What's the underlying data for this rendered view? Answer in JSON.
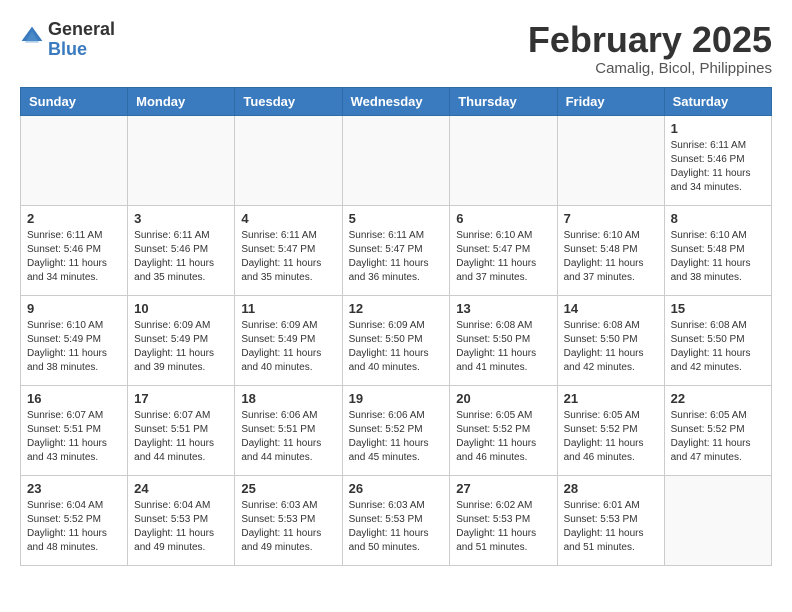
{
  "header": {
    "logo_general": "General",
    "logo_blue": "Blue",
    "month_year": "February 2025",
    "location": "Camalig, Bicol, Philippines"
  },
  "weekdays": [
    "Sunday",
    "Monday",
    "Tuesday",
    "Wednesday",
    "Thursday",
    "Friday",
    "Saturday"
  ],
  "weeks": [
    [
      {
        "day": "",
        "info": ""
      },
      {
        "day": "",
        "info": ""
      },
      {
        "day": "",
        "info": ""
      },
      {
        "day": "",
        "info": ""
      },
      {
        "day": "",
        "info": ""
      },
      {
        "day": "",
        "info": ""
      },
      {
        "day": "1",
        "info": "Sunrise: 6:11 AM\nSunset: 5:46 PM\nDaylight: 11 hours\nand 34 minutes."
      }
    ],
    [
      {
        "day": "2",
        "info": "Sunrise: 6:11 AM\nSunset: 5:46 PM\nDaylight: 11 hours\nand 34 minutes."
      },
      {
        "day": "3",
        "info": "Sunrise: 6:11 AM\nSunset: 5:46 PM\nDaylight: 11 hours\nand 35 minutes."
      },
      {
        "day": "4",
        "info": "Sunrise: 6:11 AM\nSunset: 5:47 PM\nDaylight: 11 hours\nand 35 minutes."
      },
      {
        "day": "5",
        "info": "Sunrise: 6:11 AM\nSunset: 5:47 PM\nDaylight: 11 hours\nand 36 minutes."
      },
      {
        "day": "6",
        "info": "Sunrise: 6:10 AM\nSunset: 5:47 PM\nDaylight: 11 hours\nand 37 minutes."
      },
      {
        "day": "7",
        "info": "Sunrise: 6:10 AM\nSunset: 5:48 PM\nDaylight: 11 hours\nand 37 minutes."
      },
      {
        "day": "8",
        "info": "Sunrise: 6:10 AM\nSunset: 5:48 PM\nDaylight: 11 hours\nand 38 minutes."
      }
    ],
    [
      {
        "day": "9",
        "info": "Sunrise: 6:10 AM\nSunset: 5:49 PM\nDaylight: 11 hours\nand 38 minutes."
      },
      {
        "day": "10",
        "info": "Sunrise: 6:09 AM\nSunset: 5:49 PM\nDaylight: 11 hours\nand 39 minutes."
      },
      {
        "day": "11",
        "info": "Sunrise: 6:09 AM\nSunset: 5:49 PM\nDaylight: 11 hours\nand 40 minutes."
      },
      {
        "day": "12",
        "info": "Sunrise: 6:09 AM\nSunset: 5:50 PM\nDaylight: 11 hours\nand 40 minutes."
      },
      {
        "day": "13",
        "info": "Sunrise: 6:08 AM\nSunset: 5:50 PM\nDaylight: 11 hours\nand 41 minutes."
      },
      {
        "day": "14",
        "info": "Sunrise: 6:08 AM\nSunset: 5:50 PM\nDaylight: 11 hours\nand 42 minutes."
      },
      {
        "day": "15",
        "info": "Sunrise: 6:08 AM\nSunset: 5:50 PM\nDaylight: 11 hours\nand 42 minutes."
      }
    ],
    [
      {
        "day": "16",
        "info": "Sunrise: 6:07 AM\nSunset: 5:51 PM\nDaylight: 11 hours\nand 43 minutes."
      },
      {
        "day": "17",
        "info": "Sunrise: 6:07 AM\nSunset: 5:51 PM\nDaylight: 11 hours\nand 44 minutes."
      },
      {
        "day": "18",
        "info": "Sunrise: 6:06 AM\nSunset: 5:51 PM\nDaylight: 11 hours\nand 44 minutes."
      },
      {
        "day": "19",
        "info": "Sunrise: 6:06 AM\nSunset: 5:52 PM\nDaylight: 11 hours\nand 45 minutes."
      },
      {
        "day": "20",
        "info": "Sunrise: 6:05 AM\nSunset: 5:52 PM\nDaylight: 11 hours\nand 46 minutes."
      },
      {
        "day": "21",
        "info": "Sunrise: 6:05 AM\nSunset: 5:52 PM\nDaylight: 11 hours\nand 46 minutes."
      },
      {
        "day": "22",
        "info": "Sunrise: 6:05 AM\nSunset: 5:52 PM\nDaylight: 11 hours\nand 47 minutes."
      }
    ],
    [
      {
        "day": "23",
        "info": "Sunrise: 6:04 AM\nSunset: 5:52 PM\nDaylight: 11 hours\nand 48 minutes."
      },
      {
        "day": "24",
        "info": "Sunrise: 6:04 AM\nSunset: 5:53 PM\nDaylight: 11 hours\nand 49 minutes."
      },
      {
        "day": "25",
        "info": "Sunrise: 6:03 AM\nSunset: 5:53 PM\nDaylight: 11 hours\nand 49 minutes."
      },
      {
        "day": "26",
        "info": "Sunrise: 6:03 AM\nSunset: 5:53 PM\nDaylight: 11 hours\nand 50 minutes."
      },
      {
        "day": "27",
        "info": "Sunrise: 6:02 AM\nSunset: 5:53 PM\nDaylight: 11 hours\nand 51 minutes."
      },
      {
        "day": "28",
        "info": "Sunrise: 6:01 AM\nSunset: 5:53 PM\nDaylight: 11 hours\nand 51 minutes."
      },
      {
        "day": "",
        "info": ""
      }
    ]
  ]
}
